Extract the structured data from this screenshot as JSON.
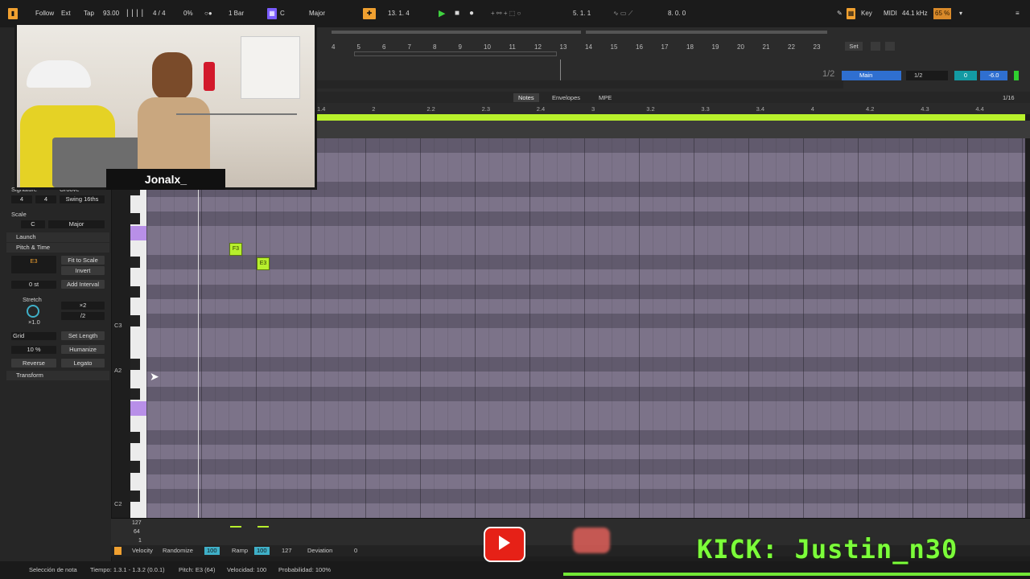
{
  "topbar": {
    "follow": "Follow",
    "ext": "Ext",
    "tap": "Tap",
    "tempo": "93.00",
    "signature": "4 / 4",
    "metro_pct": "0%",
    "quant": "1 Bar",
    "key_root": "C",
    "key_scale": "Major",
    "position": "13.  1.  4",
    "loop_start": "5.  1.  1",
    "loop_len": "8.  0.  0",
    "key_label": "Key",
    "midi_label": "MIDI",
    "sample_rate": "44.1 kHz",
    "cpu": "65 %"
  },
  "ruler": {
    "bars": [
      "4",
      "5",
      "6",
      "7",
      "8",
      "9",
      "10",
      "11",
      "12",
      "13",
      "14",
      "15",
      "16",
      "17",
      "18",
      "19",
      "20",
      "21",
      "22",
      "23"
    ]
  },
  "mixer": {
    "set_label": "Set",
    "fraction": "1/2",
    "track": "Main",
    "ch": "1/2",
    "vol": "0",
    "db": "-6.0"
  },
  "tabs": {
    "notes": "Notes",
    "envelopes": "Envelopes",
    "mpe": "MPE",
    "grid": "1/16"
  },
  "beat_ruler": [
    "1.4",
    "2",
    "2.2",
    "2.3",
    "2.4",
    "3",
    "3.2",
    "3.3",
    "3.4",
    "4",
    "4.2",
    "4.3",
    "4.4"
  ],
  "leftpanel": {
    "signature_label": "Signature",
    "groove_label": "Groove",
    "sig_num": "4",
    "sig_den": "4",
    "groove_value": "Swing 16ths",
    "scale_label": "Scale",
    "scale_root": "C",
    "scale_name": "Major",
    "launch": "Launch",
    "pitch_time": "Pitch & Time",
    "note_box": "E3",
    "fit_to_scale": "Fit to Scale",
    "invert": "Invert",
    "semis": "0 st",
    "add_interval": "Add Interval",
    "stretch": "Stretch",
    "x2": "×2",
    "half": "/2",
    "stretch_val": "×1.0",
    "grid_label": "Grid",
    "set_length": "Set Length",
    "humanize_pct": "10 %",
    "humanize": "Humanize",
    "reverse": "Reverse",
    "legato": "Legato",
    "transform": "Transform"
  },
  "keys": {
    "c3": "C3",
    "a2": "A2",
    "c2": "C2"
  },
  "notes": [
    {
      "label": "F3"
    },
    {
      "label": "E3"
    }
  ],
  "velocity": {
    "max": "127",
    "mid": "64",
    "min": "1",
    "label": "Velocity",
    "randomize": "Randomize",
    "rand_val": "100",
    "ramp": "Ramp",
    "ramp_a": "100",
    "ramp_b": "127",
    "deviation": "Deviation",
    "dev_val": "0"
  },
  "status": {
    "selection": "Selección de nota",
    "tiempo": "Tiempo: 1.3.1 - 1.3.2 (0.0.1)",
    "pitch": "Pitch: E3 (64)",
    "velocidad": "Velocidad: 100",
    "prob": "Probabilidad: 100%"
  },
  "overlay": {
    "streamer": "Jonalx_",
    "kick": "KICK: Justin_n30"
  },
  "colors": {
    "accent": "#b8f12b",
    "grid": "#7c7389",
    "orange": "#f0a030"
  }
}
